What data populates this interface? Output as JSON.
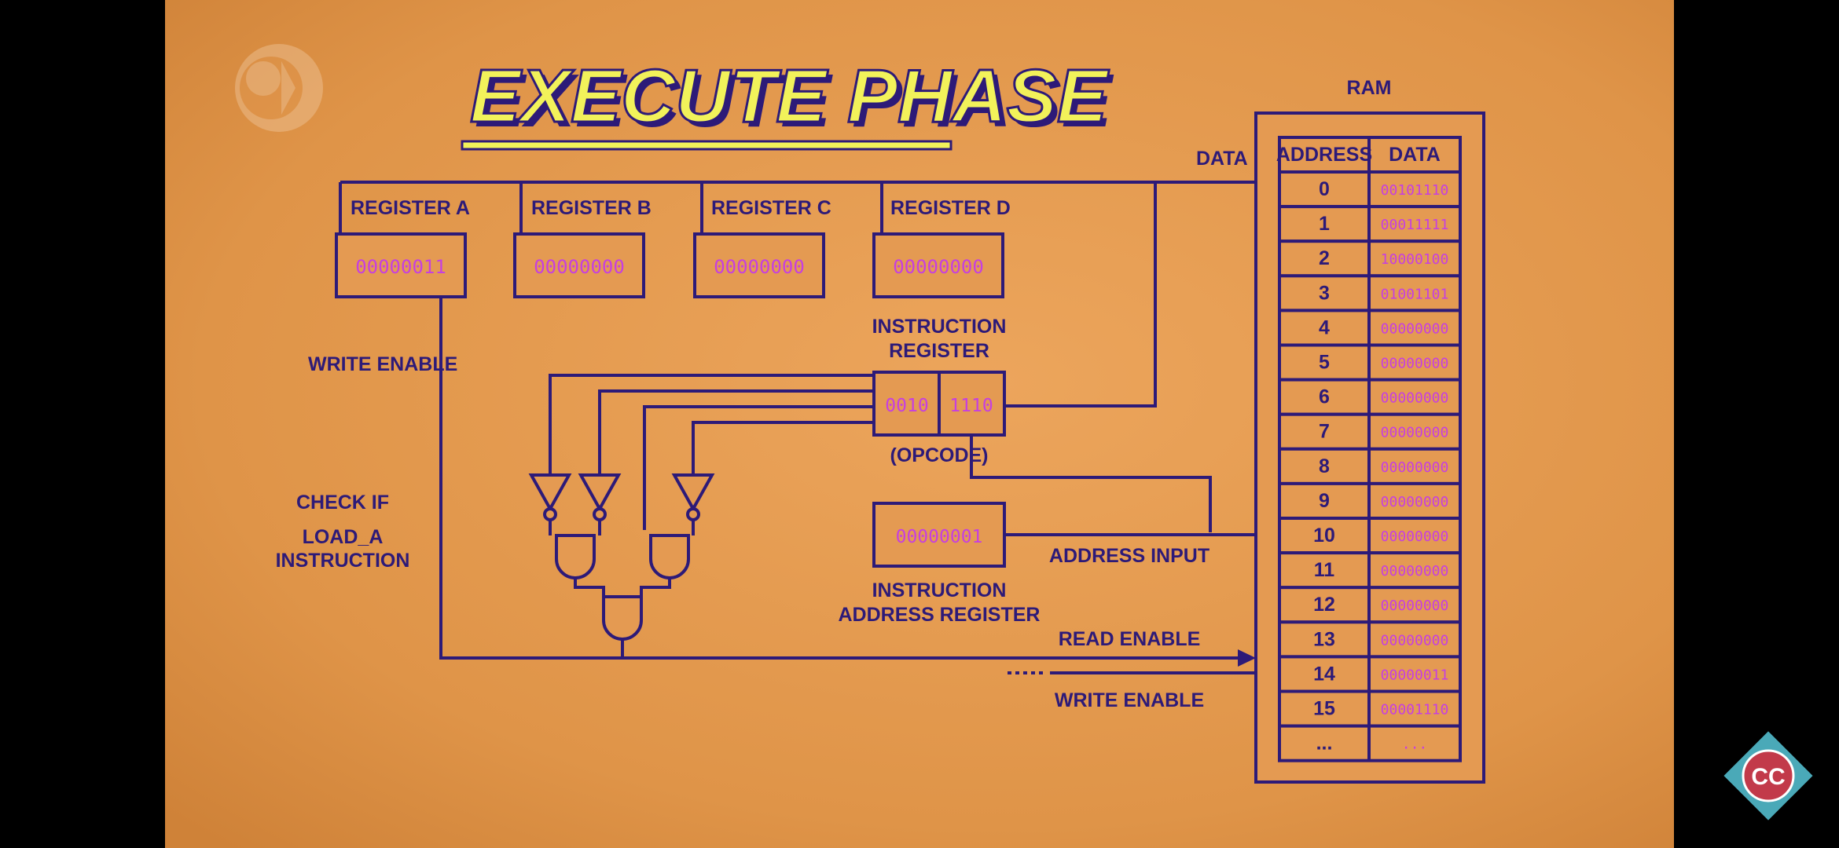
{
  "title": "EXECUTE PHASE",
  "ram": {
    "title": "RAM",
    "col_address": "ADDRESS",
    "col_data": "DATA",
    "rows": [
      {
        "address": "0",
        "data": "00101110"
      },
      {
        "address": "1",
        "data": "00011111"
      },
      {
        "address": "2",
        "data": "10000100"
      },
      {
        "address": "3",
        "data": "01001101"
      },
      {
        "address": "4",
        "data": "00000000"
      },
      {
        "address": "5",
        "data": "00000000"
      },
      {
        "address": "6",
        "data": "00000000"
      },
      {
        "address": "7",
        "data": "00000000"
      },
      {
        "address": "8",
        "data": "00000000"
      },
      {
        "address": "9",
        "data": "00000000"
      },
      {
        "address": "10",
        "data": "00000000"
      },
      {
        "address": "11",
        "data": "00000000"
      },
      {
        "address": "12",
        "data": "00000000"
      },
      {
        "address": "13",
        "data": "00000000"
      },
      {
        "address": "14",
        "data": "00000011"
      },
      {
        "address": "15",
        "data": "00001110"
      },
      {
        "address": "...",
        "data": "..."
      }
    ]
  },
  "registers": [
    {
      "label": "REGISTER A",
      "value": "00000011"
    },
    {
      "label": "REGISTER B",
      "value": "00000000"
    },
    {
      "label": "REGISTER C",
      "value": "00000000"
    },
    {
      "label": "REGISTER D",
      "value": "00000000"
    }
  ],
  "instruction_register": {
    "label_line1": "INSTRUCTION",
    "label_line2": "REGISTER",
    "opcode": "0010",
    "operand": "1110",
    "opcode_caption": "(OPCODE)"
  },
  "instruction_address_register": {
    "value": "00000001",
    "label_line1": "INSTRUCTION",
    "label_line2": "ADDRESS REGISTER"
  },
  "labels": {
    "data": "DATA",
    "write_enable_left": "WRITE ENABLE",
    "check_if": "CHECK IF",
    "load_a": "LOAD_A",
    "instruction": "INSTRUCTION",
    "address_input": "ADDRESS INPUT",
    "read_enable": "READ ENABLE",
    "write_enable_right": "WRITE ENABLE"
  },
  "logos": {
    "top_left": "pbs-logo",
    "bottom_right": "crash-course-logo",
    "bottom_right_text": "CC"
  },
  "colors": {
    "background": "#e49a52",
    "ink": "#2d1a78",
    "value": "#c63fe0",
    "title_fill": "#f2f25a",
    "letterbox": "#000000"
  }
}
